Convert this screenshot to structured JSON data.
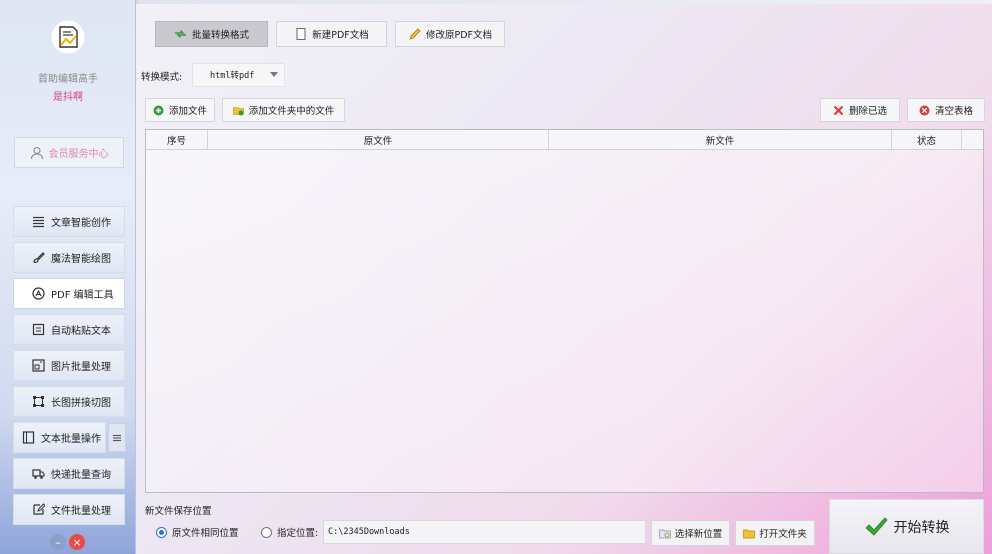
{
  "sidebar": {
    "app_name": "首助编辑高手",
    "user_name": "是抖啊",
    "member_center": "会员服务中心",
    "items": [
      {
        "label": "文章智能创作",
        "icon": "lines-icon"
      },
      {
        "label": "魔法智能绘图",
        "icon": "brush-icon"
      },
      {
        "label": "PDF 编辑工具",
        "icon": "pdf-icon"
      },
      {
        "label": "自动粘贴文本",
        "icon": "paste-icon"
      },
      {
        "label": "图片批量处理",
        "icon": "image-icon"
      },
      {
        "label": "长图拼接切图",
        "icon": "crop-icon"
      },
      {
        "label": "文本批量操作",
        "icon": "text-icon"
      },
      {
        "label": "快递批量查询",
        "icon": "truck-icon"
      },
      {
        "label": "文件批量处理",
        "icon": "file-edit-icon"
      }
    ]
  },
  "toolbar": {
    "batch_convert": "批量转换格式",
    "new_pdf": "新建PDF文档",
    "edit_pdf": "修改原PDF文档"
  },
  "mode": {
    "label": "转换模式:",
    "value": "html转pdf"
  },
  "file_actions": {
    "add_file": "添加文件",
    "add_folder": "添加文件夹中的文件",
    "delete_selected": "删除已选",
    "clear_table": "清空表格"
  },
  "table": {
    "columns": [
      "序号",
      "原文件",
      "新文件",
      "状态"
    ],
    "rows": []
  },
  "save": {
    "label": "新文件保存位置",
    "option_same": "原文件相同位置",
    "option_custom": "指定位置:",
    "path": "C:\\2345Downloads",
    "choose_location": "选择新位置",
    "open_folder": "打开文件夹"
  },
  "start_button": "开始转换",
  "colors": {
    "accent_pink": "#d6407f",
    "radio_blue": "#2f6fd8",
    "check_green": "#3aa935"
  }
}
